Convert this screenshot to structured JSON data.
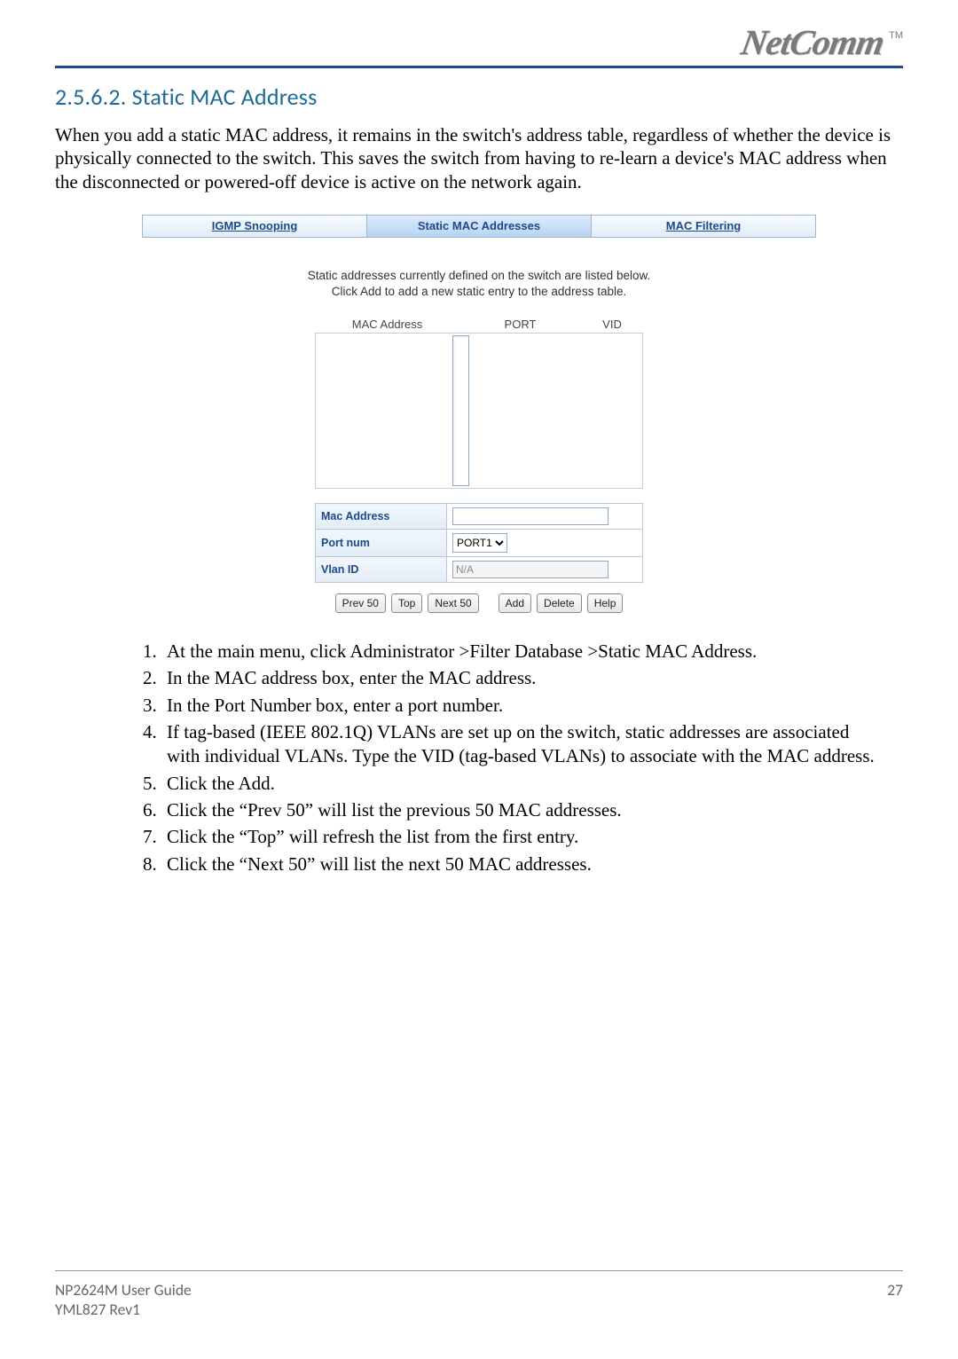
{
  "header": {
    "logo_text": "NetComm",
    "tm": "TM"
  },
  "section": {
    "number_title": "2.5.6.2. Static MAC Address",
    "intro": "When you add a static MAC address, it remains in the switch's address table, regardless of whether the device is physically connected to the switch.  This saves the switch from having to re-learn a device's MAC address when the disconnected or powered-off device is active on the network again."
  },
  "ui": {
    "tabs": {
      "igmp": "IGMP Snooping",
      "static": "Static MAC Addresses",
      "filter": "MAC Filtering"
    },
    "intro_line1": "Static addresses currently defined on the switch are listed below.",
    "intro_line2": "Click Add to add a new static entry to the address table.",
    "columns": {
      "mac": "MAC Address",
      "port": "PORT",
      "vid": "VID"
    },
    "form": {
      "mac_label": "Mac Address",
      "mac_value": "",
      "port_label": "Port num",
      "port_value": "PORT1",
      "vlan_label": "Vlan ID",
      "vlan_value": "N/A"
    },
    "buttons": {
      "prev": "Prev 50",
      "top": "Top",
      "next": "Next 50",
      "add": "Add",
      "delete": "Delete",
      "help": "Help"
    }
  },
  "steps": [
    "At the main menu, click Administrator >Filter Database >Static MAC Address.",
    "In the MAC address box, enter the MAC address.",
    "In the Port Number box, enter a port number.",
    "If tag-based (IEEE 802.1Q) VLANs are set up on the switch, static addresses are associated with individual VLANs.  Type the VID (tag-based VLANs) to associate with the MAC address.",
    "Click the Add.",
    "Click the “Prev 50” will list the previous 50 MAC addresses.",
    "Click the “Top” will refresh the list from the first entry.",
    "Click the “Next 50” will list the next 50 MAC addresses."
  ],
  "footer": {
    "line1": "NP2624M User Guide",
    "line2": "YML827 Rev1",
    "page": "27"
  }
}
